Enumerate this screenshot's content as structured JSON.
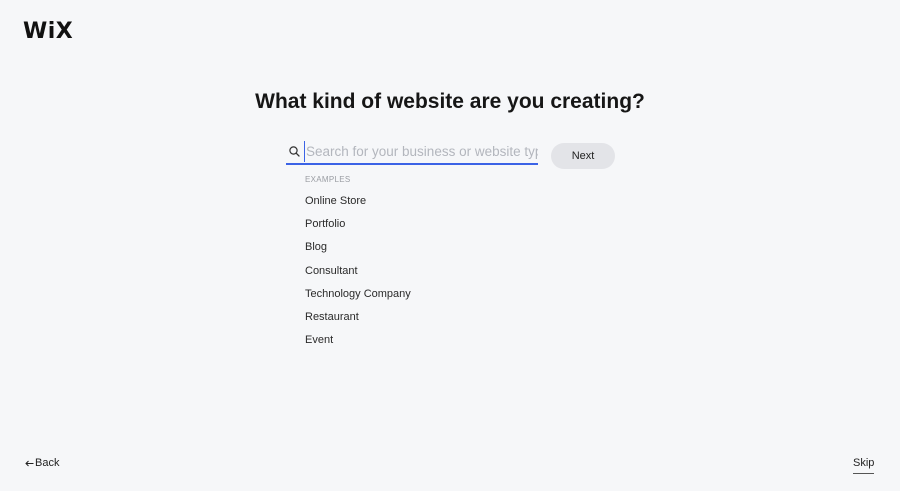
{
  "brand": {
    "logo": "WiX"
  },
  "page": {
    "title": "What kind of website are you creating?"
  },
  "search": {
    "value": "",
    "placeholder": "Search for your business or website type",
    "icon": "search-icon"
  },
  "actions": {
    "next_label": "Next",
    "back_label": "Back",
    "back_icon": "arrow-left-icon",
    "skip_label": "Skip"
  },
  "examples": {
    "label": "EXAMPLES",
    "items": [
      "Online Store",
      "Portfolio",
      "Blog",
      "Consultant",
      "Technology Company",
      "Restaurant",
      "Event"
    ]
  },
  "colors": {
    "background": "#f6f7f9",
    "accent": "#3b63e6",
    "button_bg": "#e3e4e8"
  }
}
